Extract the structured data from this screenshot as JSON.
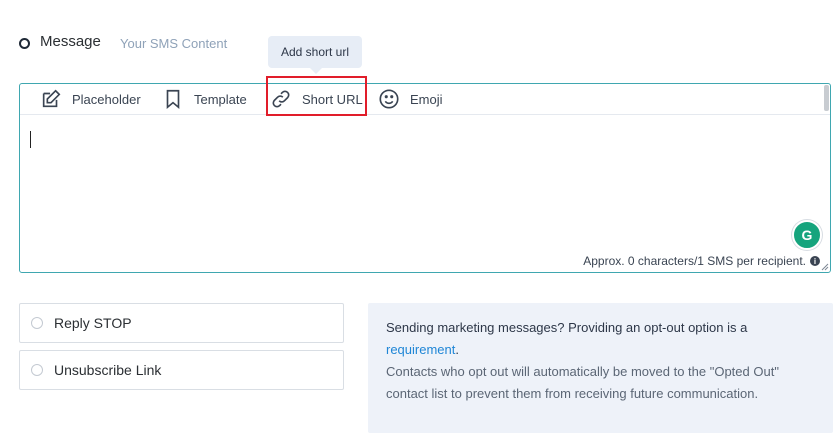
{
  "step": {
    "label": "Message",
    "sublabel": "Your SMS Content"
  },
  "tooltip": "Add short url",
  "toolbar": {
    "placeholder": {
      "label": "Placeholder",
      "icon": "edit-icon"
    },
    "template": {
      "label": "Template",
      "icon": "bookmark-icon"
    },
    "short_url": {
      "label": "Short URL",
      "icon": "link-icon"
    },
    "emoji": {
      "label": "Emoji",
      "icon": "smiley-icon"
    }
  },
  "editor": {
    "value": "",
    "counter": "Approx. 0 characters/1 SMS per recipient.",
    "grammarly_letter": "G"
  },
  "options": [
    {
      "label": "Reply STOP",
      "checked": false
    },
    {
      "label": "Unsubscribe Link",
      "checked": false
    }
  ],
  "info": {
    "line1": "Sending marketing messages? Providing an opt-out option is a",
    "link": "requirement",
    "link_suffix": ".",
    "line2": "Contacts who opt out will automatically be moved to the \"Opted Out\" contact list to prevent them from receiving future communication."
  },
  "colors": {
    "accent_border": "#3fa7b0",
    "highlight": "#e11d2a",
    "link": "#1f86d6",
    "info_bg": "#eef2f9",
    "grammarly": "#15a47d"
  }
}
